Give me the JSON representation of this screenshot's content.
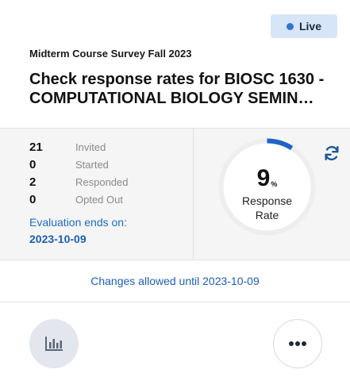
{
  "status": {
    "label": "Live",
    "color": "#2f74d0"
  },
  "survey": {
    "name": "Midterm Course Survey Fall 2023",
    "title_line1": "Check response rates for BIOSC 1630 -",
    "title_line2": "COMPUTATIONAL BIOLOGY SEMINA…"
  },
  "stats": [
    {
      "value": "21",
      "label": "Invited"
    },
    {
      "value": "0",
      "label": "Started"
    },
    {
      "value": "2",
      "label": "Responded"
    },
    {
      "value": "0",
      "label": "Opted Out"
    }
  ],
  "evaluation": {
    "ends_label": "Evaluation ends on:",
    "ends_date": "2023-10-09"
  },
  "response_rate": {
    "value": "9",
    "unit": "%",
    "fraction": 0.09,
    "caption_line1": "Response",
    "caption_line2": "Rate",
    "accent": "#1e63c6"
  },
  "icons": {
    "refresh": "refresh-icon",
    "report": "bar-chart-icon",
    "more": "more-horizontal-icon"
  },
  "changes_allowed": "Changes allowed until 2023-10-09"
}
